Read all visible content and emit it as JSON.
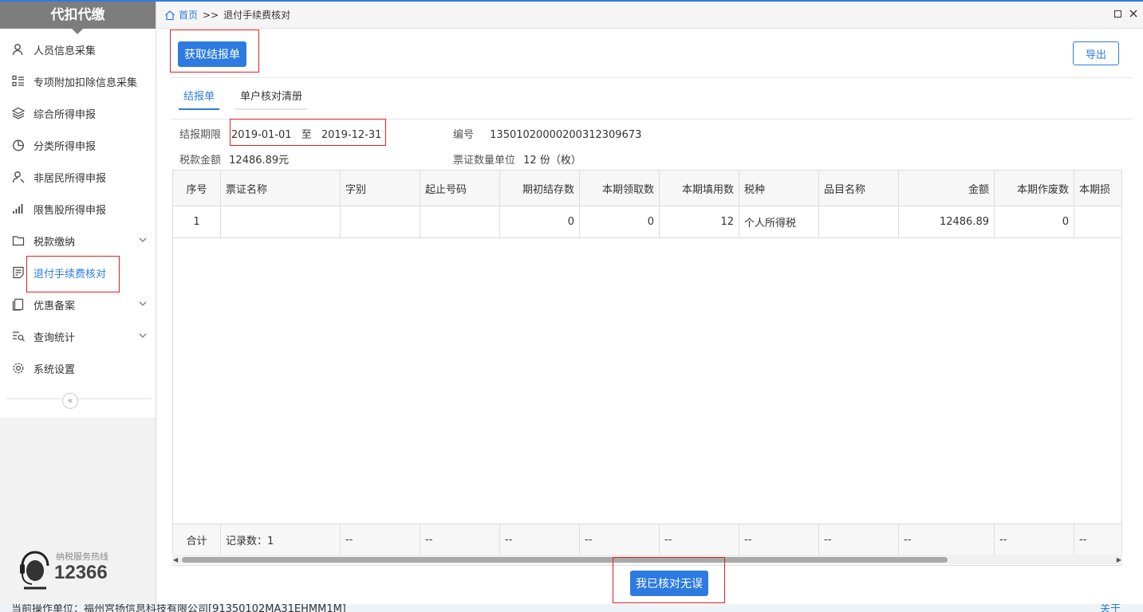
{
  "sidebar": {
    "logo": "代扣代缴",
    "items": [
      {
        "label": "人员信息采集",
        "icon": "person-icon"
      },
      {
        "label": "专项附加扣除信息采集",
        "icon": "list-icon"
      },
      {
        "label": "综合所得申报",
        "icon": "layers-icon"
      },
      {
        "label": "分类所得申报",
        "icon": "pie-icon"
      },
      {
        "label": "非居民所得申报",
        "icon": "person-outline-icon"
      },
      {
        "label": "限售股所得申报",
        "icon": "bar-chart-icon"
      },
      {
        "label": "税款缴纳",
        "icon": "folder-icon"
      },
      {
        "label": "退付手续费核对",
        "icon": "document-icon"
      },
      {
        "label": "优惠备案",
        "icon": "copy-icon"
      },
      {
        "label": "查询统计",
        "icon": "search-list-icon"
      },
      {
        "label": "系统设置",
        "icon": "gear-icon"
      }
    ],
    "collapse_symbol": "«",
    "hotline_label": "纳税服务热线",
    "hotline_number": "12366"
  },
  "breadcrumb": {
    "home": "首页",
    "separator": ">>",
    "current": "退付手续费核对"
  },
  "toolbar": {
    "fetch_label": "获取结报单",
    "export_label": "导出"
  },
  "tabs": [
    {
      "label": "结报单",
      "active": true
    },
    {
      "label": "单户核对清册",
      "active": false
    }
  ],
  "info": {
    "period_label": "结报期限",
    "period_start": "2019-01-01",
    "period_sep": "至",
    "period_end": "2019-12-31",
    "number_label": "编号",
    "number_value": "13501020000200312309673",
    "amount_label": "税款金额",
    "amount_value": "12486.89元",
    "unit_label": "票证数量单位",
    "unit_value": "12 份（枚）"
  },
  "table": {
    "headers": [
      "序号",
      "票证名称",
      "字别",
      "起止号码",
      "期初结存数",
      "本期领取数",
      "本期填用数",
      "税种",
      "品目名称",
      "金额",
      "本期作废数",
      "本期损"
    ],
    "rows": [
      [
        "1",
        "",
        "",
        "",
        "0",
        "0",
        "12",
        "个人所得税",
        "",
        "12486.89",
        "0",
        ""
      ]
    ],
    "footer": [
      "合计",
      "记录数：1",
      "--",
      "--",
      "--",
      "--",
      "--",
      "--",
      "--",
      "--",
      "--",
      "--"
    ]
  },
  "confirm_label": "我已核对无误",
  "status": {
    "text": "当前操作单位：福州宫扬信息科技有限公司[91350102MA31EHMM1M]",
    "right": "关于"
  },
  "colors": {
    "accent": "#2d7be0",
    "highlight_box": "#e02020"
  }
}
